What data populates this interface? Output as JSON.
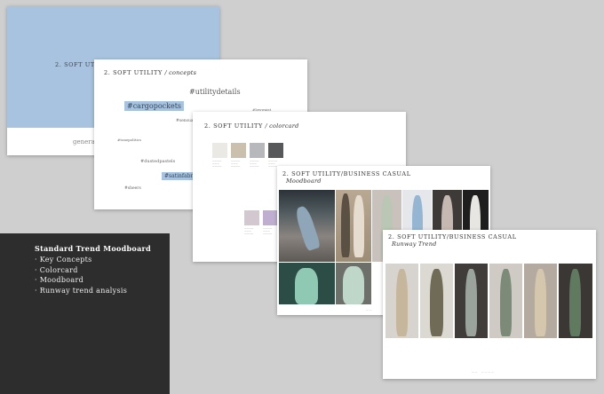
{
  "panel": {
    "title": "Standard Trend Moodboard",
    "items": [
      "Key Concepts",
      "Colorcard",
      "Moodboard",
      "Runway trend analysis"
    ]
  },
  "slide1": {
    "header": "2. SOFT UTILI",
    "subtitle": "general"
  },
  "slide2": {
    "header": "2. SOFT UTILITY",
    "header_italic": "/ concepts",
    "tags": [
      "#utilitydetails",
      "#cargopockets",
      "#lowwaist",
      "#sensual",
      "#tonepolitics",
      "#dustedpastels",
      "#satinfabric",
      "#sheers"
    ]
  },
  "slide3": {
    "header": "2. SOFT UTILITY",
    "header_italic": "/ colorcard",
    "swatch_colors": [
      "#ebe9e4",
      "#cbbfae",
      "#b6b8bb",
      "#57585a",
      "#d4c8d0",
      "#bfaed0"
    ]
  },
  "slide4": {
    "header": "2. SOFT UTILITY/BUSINESS CASUAL",
    "header_italic": "Moodboard"
  },
  "slide5": {
    "header": "2. SOFT UTILITY/BUSINESS CASUAL",
    "header_italic": "Runway Trend"
  }
}
